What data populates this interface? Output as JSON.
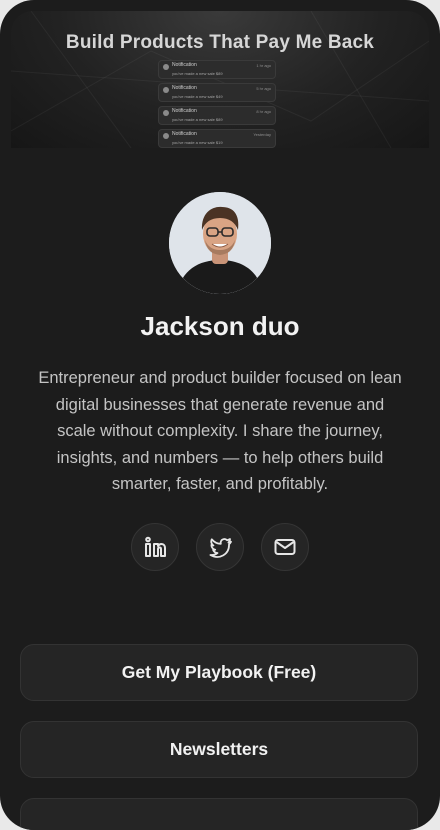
{
  "banner": {
    "title": "Build Products That Pay Me Back",
    "notifications": [
      {
        "title": "Notification",
        "time": "1 hr ago",
        "subtitle": "you've made a new sale $89"
      },
      {
        "title": "Notification",
        "time": "5 hr ago",
        "subtitle": "you've made a new sale $49"
      },
      {
        "title": "Notification",
        "time": "8 hr ago",
        "subtitle": "you've made a new sale $89"
      },
      {
        "title": "Notification",
        "time": "Yesterday",
        "subtitle": "you've made a new sale $19"
      }
    ]
  },
  "profile": {
    "name": "Jackson duo",
    "bio": "Entrepreneur and product builder focused on lean digital businesses that generate revenue and scale without complexity. I share the journey, insights, and numbers — to help others build smarter, faster, and profitably."
  },
  "socials": [
    {
      "icon": "linkedin-icon"
    },
    {
      "icon": "twitter-icon"
    },
    {
      "icon": "mail-icon"
    }
  ],
  "links": [
    {
      "label": "Get My Playbook (Free)"
    },
    {
      "label": "Newsletters"
    },
    {
      "label": ""
    }
  ],
  "colors": {
    "background": "#1c1c1c",
    "card": "#252525",
    "text": "#f2f2f2",
    "muted": "#c4c4c4"
  }
}
